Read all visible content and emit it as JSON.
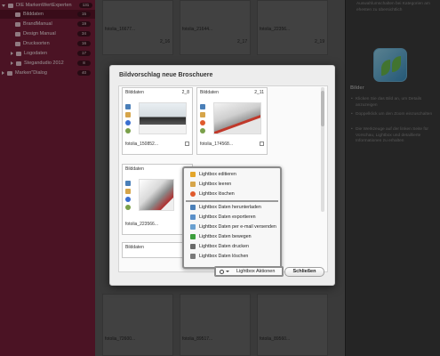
{
  "sidebar": {
    "items": [
      {
        "label": "DIE MarkenWertExperten",
        "count": "131"
      },
      {
        "label": "Bilddaten",
        "count": "15"
      },
      {
        "label": "BrandManual",
        "count": "19"
      },
      {
        "label": "Design Manual",
        "count": "34"
      },
      {
        "label": "Drucksorten",
        "count": "16"
      },
      {
        "label": "Logodaten",
        "count": "17"
      },
      {
        "label": "Stegandudio 2012",
        "count": "8"
      },
      {
        "label": "Marken\"Dialog",
        "count": "40"
      }
    ]
  },
  "grid": {
    "top_labels": [
      "fotolia_16677...",
      "fotolia_21644...",
      "fotolia_22356..."
    ],
    "top_nums": [
      "2_16",
      "2_17",
      "2_19"
    ],
    "bottom_labels": [
      "fotolia_72600...",
      "fotolia_89517...",
      "fotolia_89560..."
    ]
  },
  "right_panel": {
    "top_text": "Auswahlumschalten bei Kategorien am ehesten zu übersichtlich",
    "heading": "Bilder",
    "bullets": [
      "Klicken Sie das Bild an, um Details anzuzeigen",
      "Doppelklick um den Zoom einzuschalten",
      "Die Werkzeuge auf der linken Seite für Vorschau, Lightbox und detaillierte Informationen zu erhalten"
    ]
  },
  "dialog": {
    "title": "Bildvorschlag neue Broschuere",
    "cards": [
      {
        "title": "Bilddaten",
        "num": "2_8",
        "filename": "fotolia_150852..."
      },
      {
        "title": "Bilddaten",
        "num": "2_11",
        "filename": "fotolia_174568..."
      },
      {
        "title": "Bilddaten",
        "num": "",
        "filename": "fotolia_223566..."
      },
      {
        "title": "Bilddaten",
        "num": "",
        "filename": ""
      }
    ],
    "close_label": "Schließen",
    "actions_label": "Lightbox Aktionen"
  },
  "menu": {
    "items": [
      {
        "label": "Lightbox editieren",
        "icon": "pencil-icon",
        "color": "#e3a52a"
      },
      {
        "label": "Lightbox leeren",
        "icon": "broom-icon",
        "color": "#d6a54a"
      },
      {
        "label": "Lightbox löschen",
        "icon": "delete-icon",
        "color": "#e05a2d"
      },
      {
        "label": "Lightbox Daten herunterladen",
        "icon": "download-icon",
        "color": "#4a7fb8"
      },
      {
        "label": "Lightbox Daten exportieren",
        "icon": "export-icon",
        "color": "#5a8fc8"
      },
      {
        "label": "Lightbox Daten per e-mail versenden",
        "icon": "mail-icon",
        "color": "#6aa0d0"
      },
      {
        "label": "Lightbox Daten bewegen",
        "icon": "move-icon",
        "color": "#3c9e3c"
      },
      {
        "label": "Lightbox Daten drucken",
        "icon": "print-icon",
        "color": "#6a6a6a"
      },
      {
        "label": "Lightbox Daten löschen",
        "icon": "trash-icon",
        "color": "#7a7a7a"
      }
    ]
  }
}
